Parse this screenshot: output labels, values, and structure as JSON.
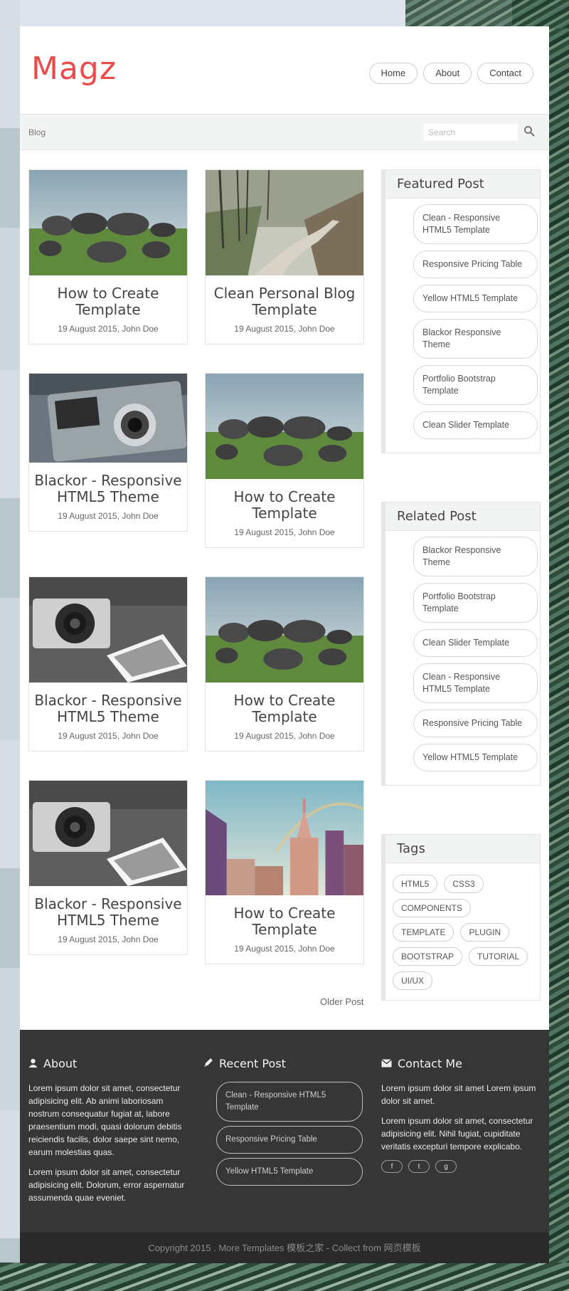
{
  "brand": {
    "logo": "Magz",
    "accent": "#ea4c4c"
  },
  "nav": [
    {
      "label": "Home"
    },
    {
      "label": "About"
    },
    {
      "label": "Contact"
    }
  ],
  "breadcrumb": "Blog",
  "search": {
    "placeholder": "Search"
  },
  "posts": [
    {
      "title": "How to Create Template",
      "meta": "19 August 2015, John Doe",
      "image": "rocks"
    },
    {
      "title": "Clean Personal Blog Template",
      "meta": "19 August 2015, John Doe",
      "image": "forest-road"
    },
    {
      "title": "Blackor - Responsive HTML5 Theme",
      "meta": "19 August 2015, John Doe",
      "image": "polaroid-camera"
    },
    {
      "title": "How to Create Template",
      "meta": "19 August 2015, John Doe",
      "image": "rocks"
    },
    {
      "title": "Blackor - Responsive HTML5 Theme",
      "meta": "19 August 2015, John Doe",
      "image": "camera-photo"
    },
    {
      "title": "How to Create Template",
      "meta": "19 August 2015, John Doe",
      "image": "rocks"
    },
    {
      "title": "Blackor - Responsive HTML5 Theme",
      "meta": "19 August 2015, John Doe",
      "image": "camera-photo"
    },
    {
      "title": "How to Create Template",
      "meta": "19 August 2015, John Doe",
      "image": "city"
    }
  ],
  "older_post": "Older Post",
  "featured": {
    "title": "Featured Post",
    "items": [
      "Clean - Responsive HTML5 Template",
      "Responsive Pricing Table",
      "Yellow HTML5 Template",
      "Blackor Responsive Theme",
      "Portfolio Bootstrap Template",
      "Clean Slider Template"
    ]
  },
  "related": {
    "title": "Related Post",
    "items": [
      "Blackor Responsive Theme",
      "Portfolio Bootstrap Template",
      "Clean Slider Template",
      "Clean - Responsive HTML5 Template",
      "Responsive Pricing Table",
      "Yellow HTML5 Template"
    ]
  },
  "tags": {
    "title": "Tags",
    "items": [
      "HTML5",
      "CSS3",
      "COMPONENTS",
      "TEMPLATE",
      "PLUGIN",
      "BOOTSTRAP",
      "TUTORIAL",
      "UI/UX"
    ]
  },
  "footer": {
    "about": {
      "title": "About",
      "paragraphs": [
        "Lorem ipsum dolor sit amet, consectetur adipisicing elit. Ab animi laboriosam nostrum consequatur fugiat at, labore praesentium modi, quasi dolorum debitis reiciendis facilis, dolor saepe sint nemo, earum molestias quas.",
        "Lorem ipsum dolor sit amet, consectetur adipisicing elit. Dolorum, error aspernatur assumenda quae eveniet."
      ]
    },
    "recent": {
      "title": "Recent Post",
      "items": [
        "Clean - Responsive HTML5 Template",
        "Responsive Pricing Table",
        "Yellow HTML5 Template"
      ]
    },
    "contact": {
      "title": "Contact Me",
      "paragraphs": [
        "Lorem ipsum dolor sit amet Lorem ipsum dolor sit amet.",
        "Lorem ipsum dolor sit amet, consectetur adipisicing elit. Nihil fugiat, cupiditate veritatis excepturi tempore explicabo."
      ],
      "social": [
        {
          "icon": "facebook-icon",
          "glyph": "f"
        },
        {
          "icon": "twitter-icon",
          "glyph": "t"
        },
        {
          "icon": "google-plus-icon",
          "glyph": "g"
        }
      ]
    },
    "copyright": "Copyright 2015 . More Templates 模板之家 - Collect from 网页模板"
  }
}
